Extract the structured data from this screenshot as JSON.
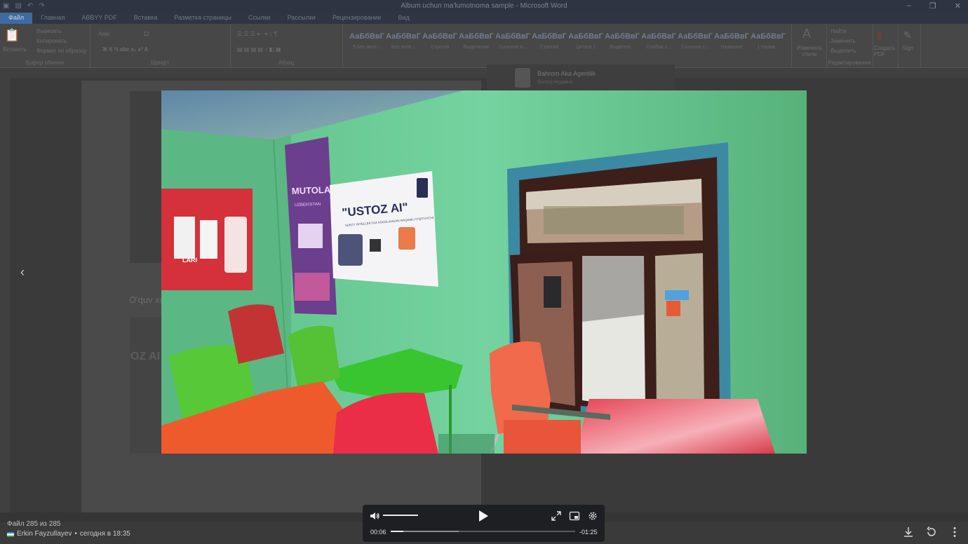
{
  "background_app": {
    "window_title": "Album uchun ma'lumotnoma sample  -  Microsoft Word",
    "tabs": [
      "Файл",
      "Главная",
      "ABBYY PDF",
      "Вставка",
      "Разметка страницы",
      "Ссылки",
      "Рассылки",
      "Рецензирование",
      "Вид"
    ],
    "ribbon_groups": {
      "clipboard": {
        "label": "Буфер обмена",
        "paste": "Вставить",
        "cut": "Вырезать",
        "copy": "Копировать",
        "format_painter": "Формат по образцу"
      },
      "font": {
        "label": "Шрифт",
        "name": "Arial",
        "size": "12"
      },
      "paragraph": {
        "label": "Абзац"
      },
      "styles": [
        {
          "sample": "АаБбВвГ",
          "name": "¶ Без инте..."
        },
        {
          "sample": "AaБбВвГ",
          "name": "Без инте..."
        },
        {
          "sample": "АаБбВвГ",
          "name": "Строгий"
        },
        {
          "sample": "АаБбВвГ",
          "name": "Выделение"
        },
        {
          "sample": "АаБбВвГ",
          "name": "Сильное в..."
        },
        {
          "sample": "АаБбВвГ",
          "name": "Строгий"
        },
        {
          "sample": "АаБбВвГ",
          "name": "Цитата 2"
        },
        {
          "sample": "АаБбВвГ",
          "name": "Выделен..."
        },
        {
          "sample": "АаБбВвГ",
          "name": "Слабая с..."
        },
        {
          "sample": "АаБбВвГ",
          "name": "Сильная с..."
        },
        {
          "sample": "АаБбВвГ",
          "name": "Название"
        },
        {
          "sample": "АаБбВвГ",
          "name": "1 Назва..."
        }
      ],
      "change_styles": "Изменить стили",
      "editing": {
        "find": "Найти",
        "replace": "Заменить",
        "select": "Выделить",
        "label": "Редактирование"
      },
      "create_pdf": "Создать PDF",
      "sign": "Sign"
    },
    "chat": {
      "name": "Bahrom Aka Agentlik",
      "status": "был(а) недавно"
    },
    "page_text": "O'quv xo",
    "image_text": "OZ AI"
  },
  "photo": {
    "posters": [
      {
        "id": "poster_1",
        "title": "MUTOLAA",
        "subtitle": "UZBEKISTAN"
      },
      {
        "id": "poster_2",
        "title": "\"USTOZ AI\"",
        "subtitle": "SUN'IY INTELLEKTGA ASOSLANGAN RAQAMLI O'QITUVCHI"
      },
      {
        "id": "poster_3",
        "title": "LARI",
        "subtitle": ""
      }
    ]
  },
  "viewer": {
    "counter": "Файл 285 из 285",
    "author": "Erkin Fayzullayev",
    "date": "сегодня в 18:35",
    "player": {
      "current_time": "00:06",
      "remaining_time": "-01:25",
      "progress": 0.07,
      "buffered": 0.37,
      "volume": 1.0
    },
    "accent": "#ededed"
  }
}
